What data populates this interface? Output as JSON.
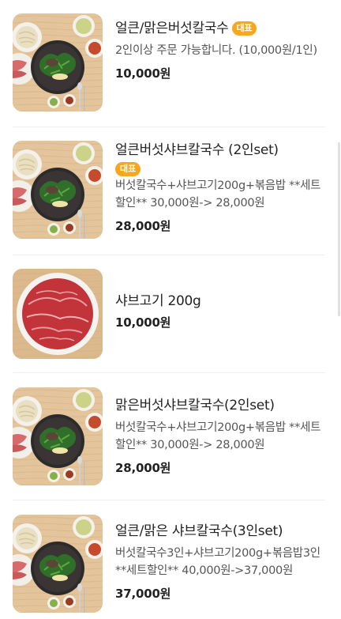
{
  "menu": [
    {
      "title": "얼큰/맑은버섯칼국수",
      "badge": "대표",
      "description": "2인이상 주문 가능합니다. (10,000원/1인)",
      "price": "10,000원",
      "image": "set-meal"
    },
    {
      "title": "얼큰버섯샤브칼국수 (2인set)",
      "badge": "대표",
      "description": "버섯칼국수+샤브고기200g+볶음밥 **세트할인** 30,000원-> 28,000원",
      "price": "28,000원",
      "image": "set-meal"
    },
    {
      "title": "샤브고기 200g",
      "badge": "",
      "description": "",
      "price": "10,000원",
      "image": "sliced-beef"
    },
    {
      "title": "맑은버섯샤브칼국수(2인set)",
      "badge": "",
      "description": "버섯칼국수+샤브고기200g+볶음밥 **세트할인** 30,000원-> 28,000원",
      "price": "28,000원",
      "image": "set-meal"
    },
    {
      "title": "얼큰/맑은 샤브칼국수(3인set)",
      "badge": "",
      "description": "버섯칼국수3인+샤브고기200g+볶음밥3인 **세트할인** 40,000원->37,000원",
      "price": "37,000원",
      "image": "set-meal"
    }
  ]
}
